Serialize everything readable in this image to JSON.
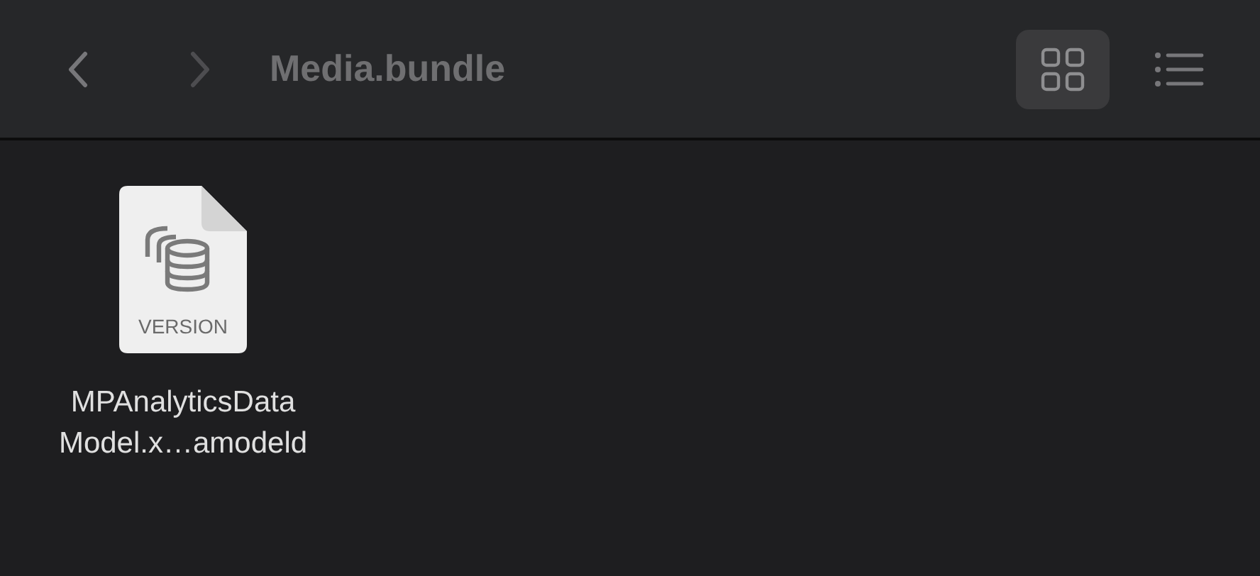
{
  "window": {
    "title": "Media.bundle"
  },
  "navigation": [
    {
      "kind": "back",
      "disabled": false
    },
    {
      "kind": "forward",
      "disabled": true
    }
  ],
  "view_modes": [
    {
      "kind": "grid",
      "selected": true
    },
    {
      "kind": "list",
      "selected": false
    }
  ],
  "files": [
    {
      "badge": "VERSION",
      "name_lines": [
        "MPAnalyticsData",
        "Model.x…amodeld"
      ]
    }
  ]
}
